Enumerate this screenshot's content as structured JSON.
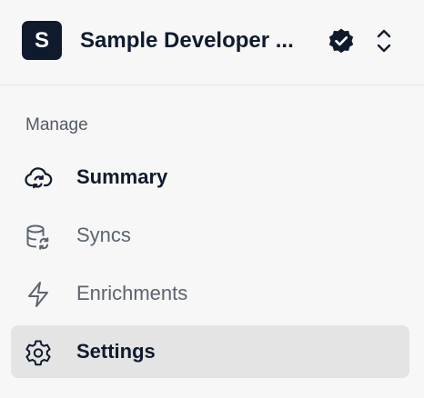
{
  "org": {
    "avatar_letter": "S",
    "name": "Sample Developer ...",
    "verified_icon": "verified-badge-icon",
    "switcher_icon": "chevron-up-down-icon"
  },
  "sidebar": {
    "section_label": "Manage",
    "items": [
      {
        "label": "Summary",
        "icon": "cloud-sync-icon",
        "active": false
      },
      {
        "label": "Syncs",
        "icon": "database-sync-icon",
        "active": false
      },
      {
        "label": "Enrichments",
        "icon": "lightning-icon",
        "active": false
      },
      {
        "label": "Settings",
        "icon": "gear-icon",
        "active": true
      }
    ]
  },
  "colors": {
    "primary_text": "#0f1b2d",
    "muted_text": "#5b6470",
    "active_background": "#e4e4e4",
    "page_background": "#f7f7f7"
  }
}
